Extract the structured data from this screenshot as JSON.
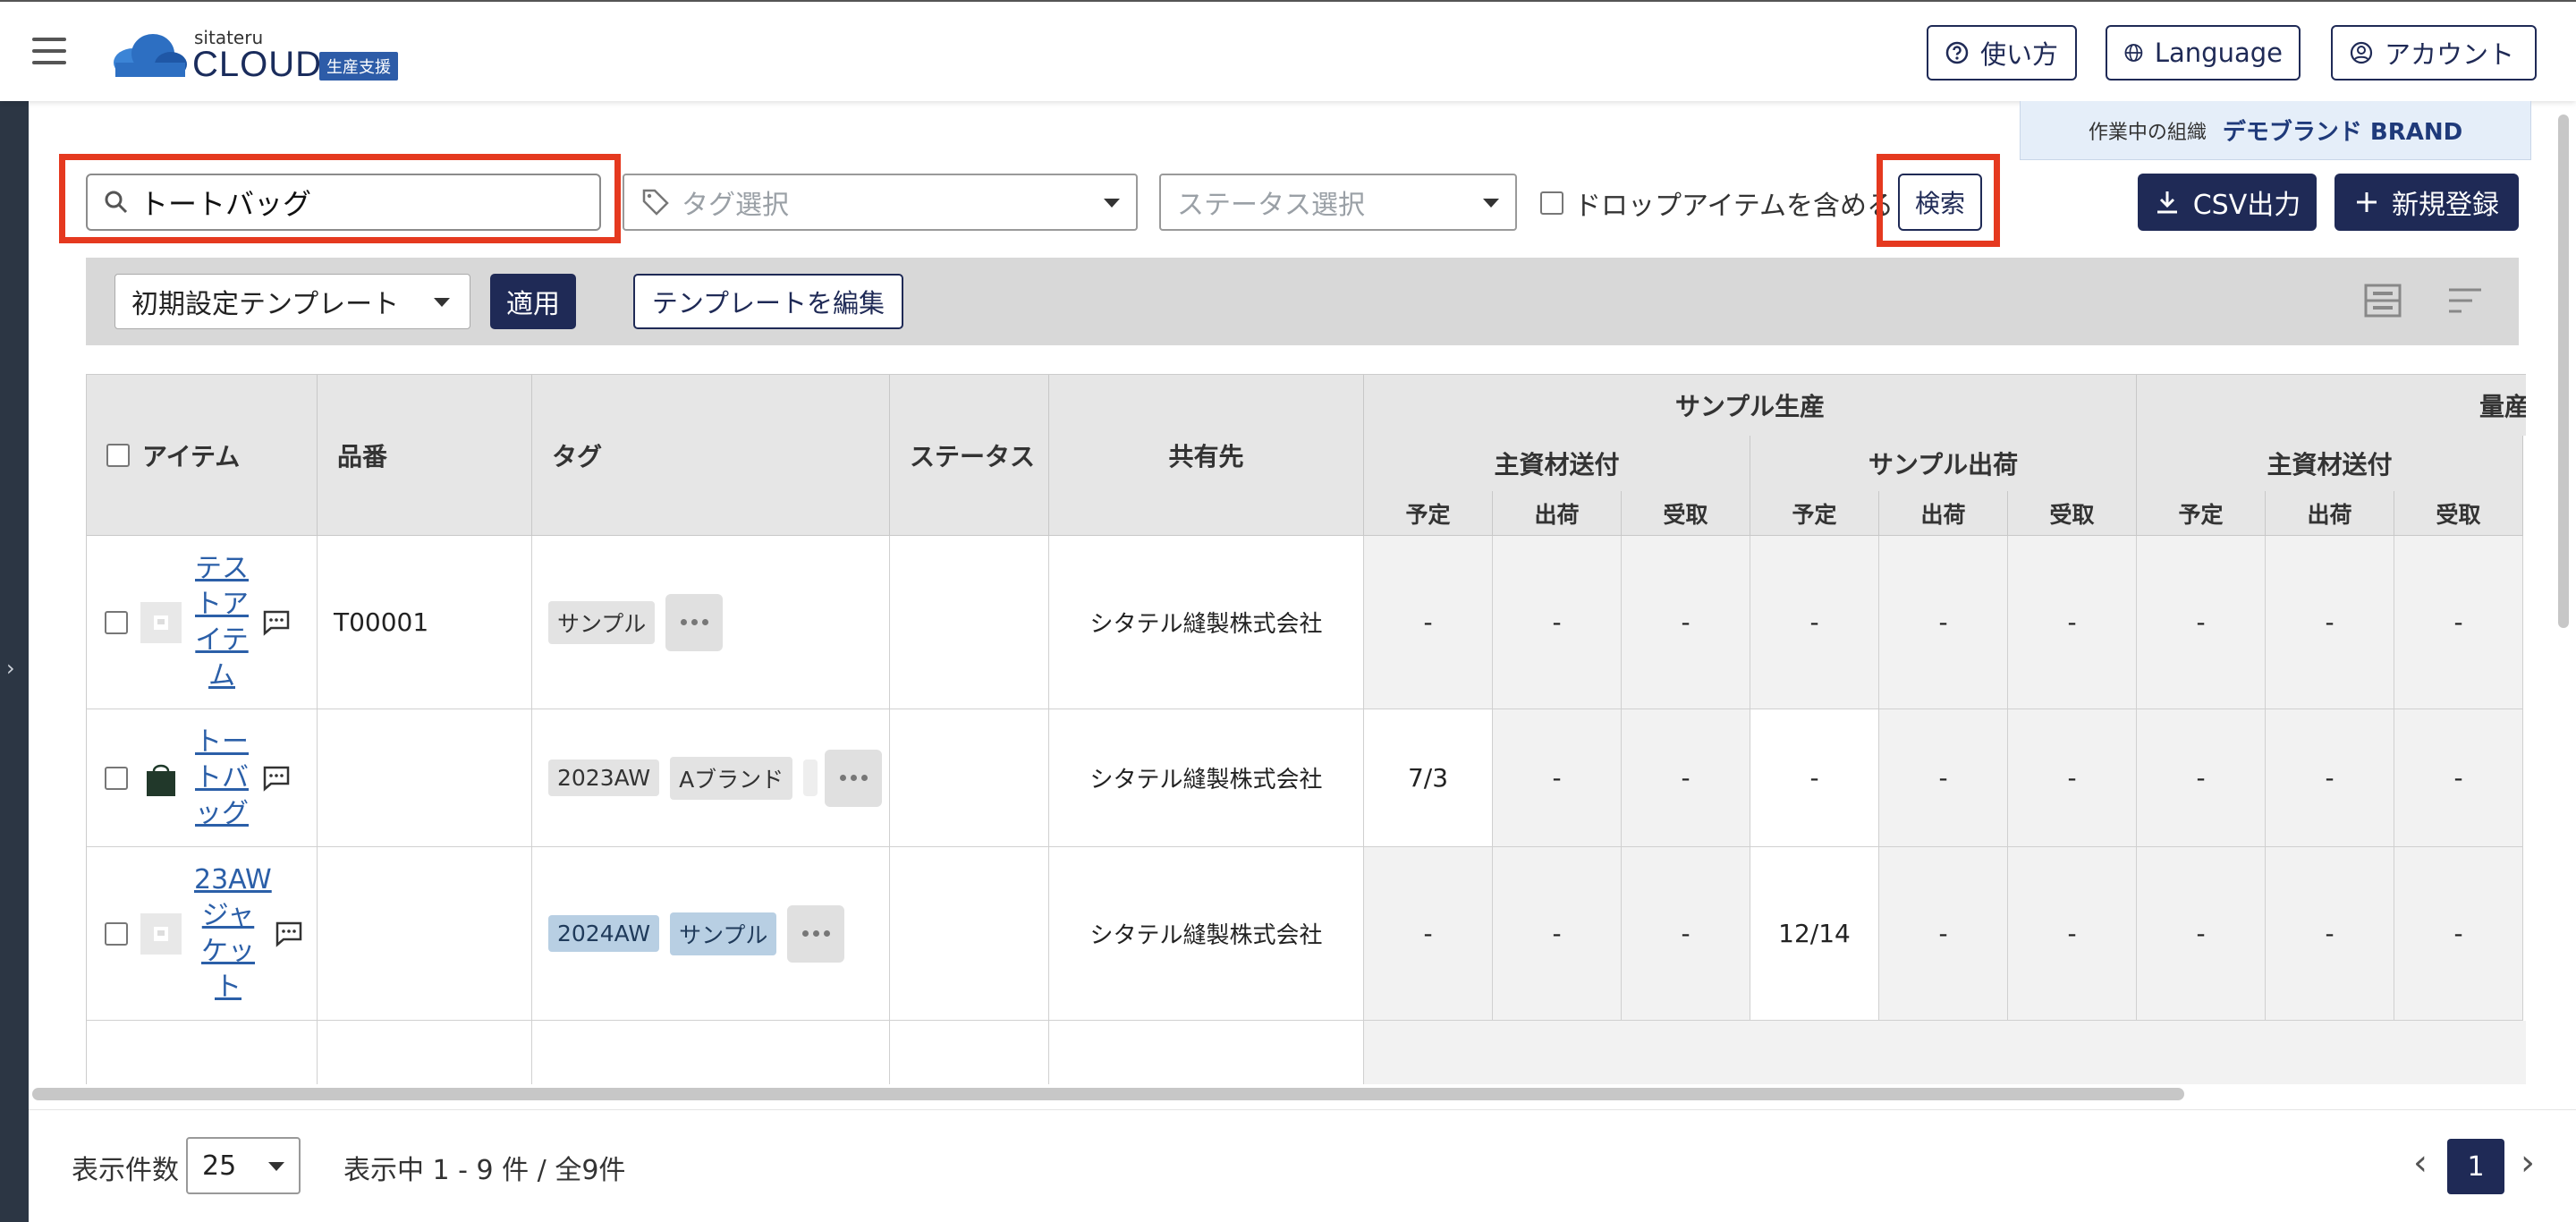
{
  "header": {
    "logo_small": "sitateru",
    "logo_main": "CLOUD",
    "logo_badge": "生産支援",
    "help_label": "使い方",
    "language_label": "Language",
    "account_label": "アカウント"
  },
  "org": {
    "label": "作業中の組織",
    "name": "デモブランド BRAND"
  },
  "filters": {
    "search_value": "トートバッグ",
    "tag_placeholder": "タグ選択",
    "status_placeholder": "ステータス選択",
    "drop_label": "ドロップアイテムを含める",
    "search_button": "検索",
    "csv_button": "CSV出力",
    "new_button": "新規登録"
  },
  "template": {
    "selected": "初期設定テンプレート",
    "apply_button": "適用",
    "edit_button": "テンプレートを編集"
  },
  "table": {
    "headers": {
      "item": "アイテム",
      "code": "品番",
      "tag": "タグ",
      "status": "ステータス",
      "share": "共有先",
      "sample_group": "サンプル生産",
      "mass_group": "量産",
      "material_send": "主資材送付",
      "sample_ship": "サンプル出荷",
      "mass_material_send": "主資材送付",
      "planned": "予定",
      "shipped": "出荷",
      "received": "受取"
    },
    "rows": [
      {
        "item": "テストアイテム",
        "code": "T00001",
        "tags": [
          "サンプル"
        ],
        "share": "シタテル縫製株式会社",
        "values": [
          "-",
          "-",
          "-",
          "-",
          "-",
          "-",
          "-",
          "-",
          "-"
        ]
      },
      {
        "item": "トートバッグ",
        "code": "",
        "tags": [
          "2023AW",
          "Aブランド"
        ],
        "share": "シタテル縫製株式会社",
        "values": [
          "7/3",
          "-",
          "-",
          "-",
          "-",
          "-",
          "-",
          "-",
          "-"
        ]
      },
      {
        "item": "23AWジャケット",
        "code": "",
        "tags": [
          "2024AW",
          "サンプル"
        ],
        "share": "シタテル縫製株式会社",
        "values": [
          "-",
          "-",
          "-",
          "12/14",
          "-",
          "-",
          "-",
          "-",
          "-"
        ]
      }
    ]
  },
  "footer": {
    "per_page_label": "表示件数",
    "per_page_value": "25",
    "range_text": "表示中 1 - 9 件 / 全9件",
    "current_page": "1"
  }
}
